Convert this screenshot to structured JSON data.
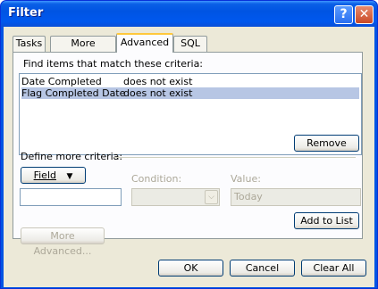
{
  "window": {
    "title": "Filter",
    "help_glyph": "?",
    "close_glyph": "✕"
  },
  "tabs": [
    {
      "label": "Tasks"
    },
    {
      "label": "More Choices"
    },
    {
      "label": "Advanced"
    },
    {
      "label": "SQL"
    }
  ],
  "criteria": {
    "heading": "Find items that match these criteria:",
    "items": [
      {
        "field": "Date Completed",
        "condition": "does not exist",
        "selected": false
      },
      {
        "field": "Flag Completed Date",
        "condition": "does not exist",
        "selected": true
      }
    ],
    "remove_label": "Remove"
  },
  "define": {
    "heading": "Define more criteria:",
    "field_button_label": "Field",
    "field_button_arrow": "▼",
    "field_input_value": "",
    "condition_label": "Condition:",
    "condition_value": "",
    "value_label": "Value:",
    "value_text": "Today",
    "add_label": "Add to List",
    "more_advanced_label": "More Advanced..."
  },
  "footer": {
    "ok_label": "OK",
    "cancel_label": "Cancel",
    "clear_label": "Clear All"
  }
}
